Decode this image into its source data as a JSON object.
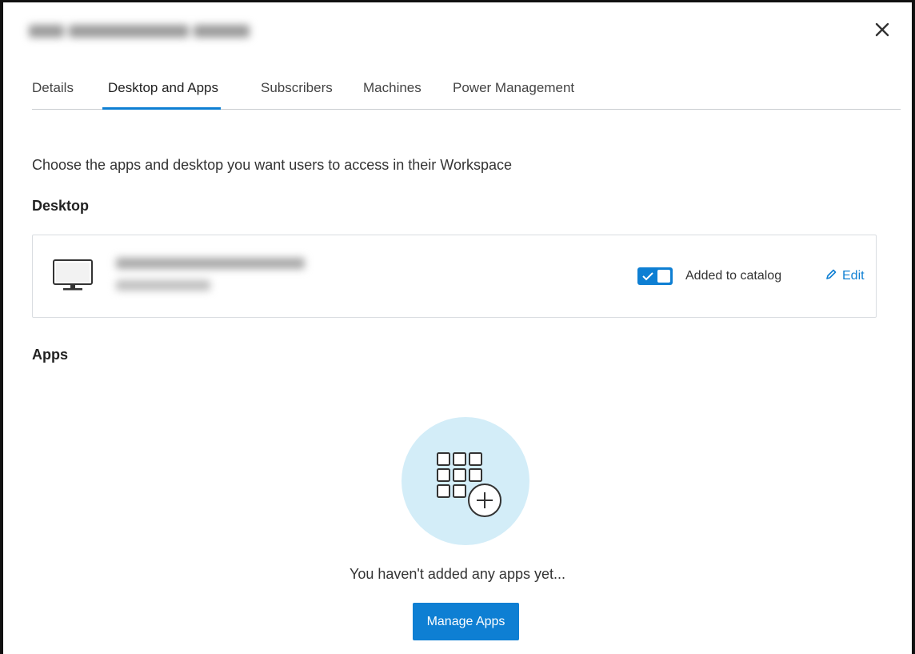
{
  "panel": {
    "close_icon": "close-icon"
  },
  "tabs": [
    {
      "label": "Details",
      "active": false
    },
    {
      "label": "Desktop and Apps",
      "active": true
    },
    {
      "label": "Subscribers",
      "active": false
    },
    {
      "label": "Machines",
      "active": false
    },
    {
      "label": "Power Management",
      "active": false
    }
  ],
  "intro_text": "Choose the apps and desktop you want users to access in their Workspace",
  "desktop_section": {
    "heading": "Desktop",
    "card": {
      "icon": "monitor-icon",
      "toggle_on": true,
      "toggle_label": "Added to catalog",
      "edit_label": "Edit",
      "edit_icon": "pencil-icon"
    }
  },
  "apps_section": {
    "heading": "Apps",
    "empty_icon": "app-grid-add-icon",
    "empty_text": "You haven't added any apps yet...",
    "manage_button": "Manage Apps"
  },
  "colors": {
    "accent": "#0e7fd3",
    "illustration_bg": "#d3edf8"
  }
}
